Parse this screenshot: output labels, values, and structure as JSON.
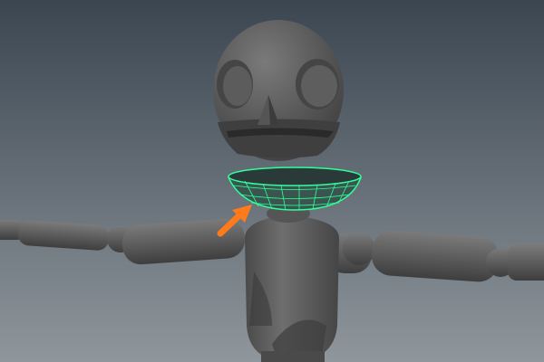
{
  "viewport": {
    "background_top": "#3b4651",
    "background_bottom": "#8f969c",
    "model_color": "#5a5a5a",
    "selection_color": "#2fff9a",
    "arrow_color": "#ff7a1a"
  },
  "icons": [
    "character-model",
    "selected-wireframe-mesh",
    "pointer-arrow-icon"
  ]
}
